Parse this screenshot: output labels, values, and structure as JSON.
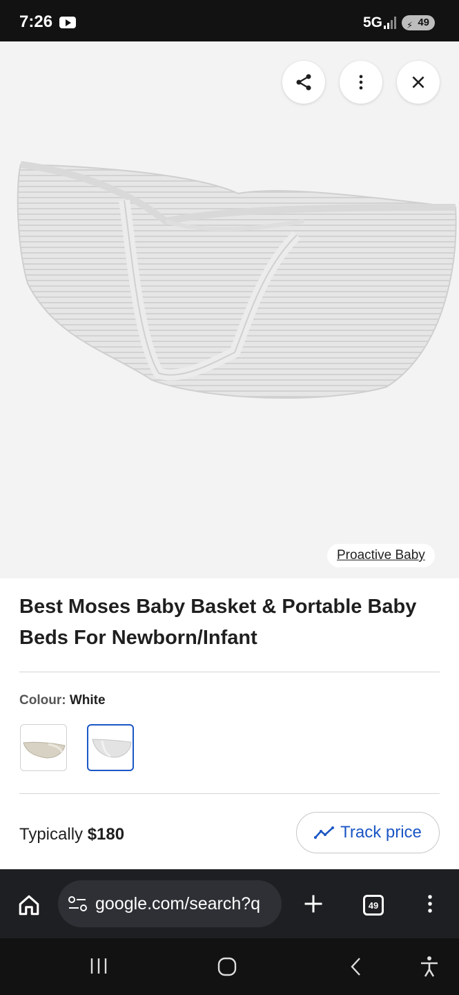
{
  "status_bar": {
    "time": "7:26",
    "network": "5G",
    "battery": "49",
    "icons": [
      "youtube-icon",
      "signal-icon",
      "battery-icon"
    ]
  },
  "viewer": {
    "actions": [
      "share-icon",
      "more-vert-icon",
      "close-icon"
    ],
    "source_label": "Proactive Baby"
  },
  "product": {
    "title": "Best Moses Baby Basket & Portable Baby Beds For Newborn/Infant",
    "colour_label": "Colour:",
    "colour_value": "White",
    "swatches": [
      "beige-basket",
      "white-basket"
    ],
    "selected_swatch": 1,
    "price_text_prefix": "Typically",
    "price": "$180",
    "track_label": "Track price"
  },
  "browser": {
    "url": "google.com/search?q",
    "tab_count": "49",
    "icons": [
      "home-icon",
      "site-settings-icon",
      "new-tab-icon",
      "tabs-icon",
      "more-vert-icon"
    ]
  },
  "nav": {
    "icons": [
      "recents-icon",
      "home-button-icon",
      "back-icon",
      "accessibility-icon"
    ]
  },
  "colors": {
    "accent": "#1a56c4",
    "status_bg": "#121212",
    "browser_bg": "#1e1f22",
    "image_bg": "#f3f3f3"
  }
}
